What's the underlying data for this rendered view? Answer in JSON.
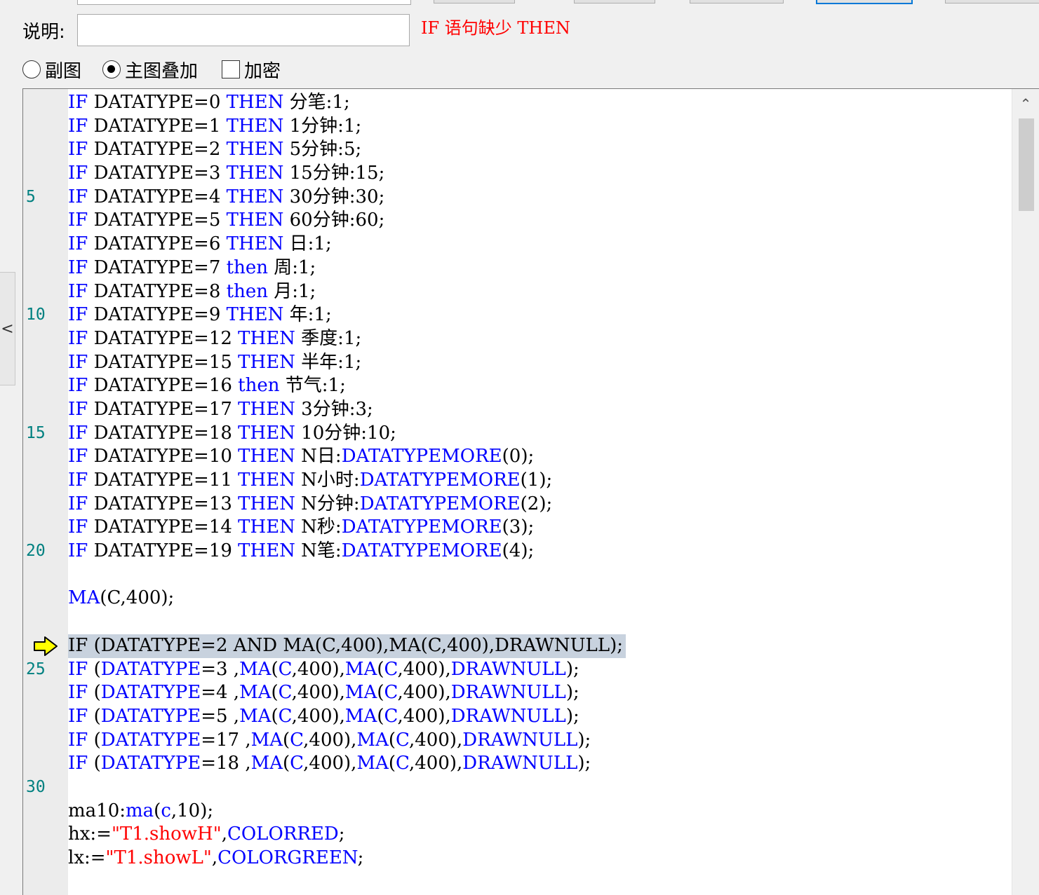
{
  "description": {
    "label": "说明:",
    "value": "",
    "error": "IF 语句缺少 THEN"
  },
  "options": {
    "radio_subchart": "副图",
    "radio_overlay": "主图叠加",
    "radio_selected": "主图叠加",
    "checkbox_encrypt": "加密",
    "checkbox_encrypt_checked": false
  },
  "side_handle": {
    "icon": "chevron-left-icon",
    "glyph": "<"
  },
  "editor": {
    "current_line": 24,
    "lines": [
      {
        "n": "",
        "tokens": [
          {
            "t": "IF",
            "c": "kw"
          },
          {
            "t": " DATATYPE=0 "
          },
          {
            "t": "THEN",
            "c": "kw"
          },
          {
            "t": " 分笔:1;"
          }
        ]
      },
      {
        "n": "",
        "tokens": [
          {
            "t": "IF",
            "c": "kw"
          },
          {
            "t": " DATATYPE=1 "
          },
          {
            "t": "THEN",
            "c": "kw"
          },
          {
            "t": " 1分钟:1;"
          }
        ]
      },
      {
        "n": "",
        "tokens": [
          {
            "t": "IF",
            "c": "kw"
          },
          {
            "t": " DATATYPE=2 "
          },
          {
            "t": "THEN",
            "c": "kw"
          },
          {
            "t": " 5分钟:5;"
          }
        ]
      },
      {
        "n": "",
        "tokens": [
          {
            "t": "IF",
            "c": "kw"
          },
          {
            "t": " DATATYPE=3 "
          },
          {
            "t": "THEN",
            "c": "kw"
          },
          {
            "t": " 15分钟:15;"
          }
        ]
      },
      {
        "n": "5",
        "tokens": [
          {
            "t": "IF",
            "c": "kw"
          },
          {
            "t": " DATATYPE=4 "
          },
          {
            "t": "THEN",
            "c": "kw"
          },
          {
            "t": " 30分钟:30;"
          }
        ]
      },
      {
        "n": "",
        "tokens": [
          {
            "t": "IF",
            "c": "kw"
          },
          {
            "t": " DATATYPE=5 "
          },
          {
            "t": "THEN",
            "c": "kw"
          },
          {
            "t": " 60分钟:60;"
          }
        ]
      },
      {
        "n": "",
        "tokens": [
          {
            "t": "IF",
            "c": "kw"
          },
          {
            "t": " DATATYPE=6 "
          },
          {
            "t": "THEN",
            "c": "kw"
          },
          {
            "t": " 日:1;"
          }
        ]
      },
      {
        "n": "",
        "tokens": [
          {
            "t": "IF",
            "c": "kw"
          },
          {
            "t": " DATATYPE=7 "
          },
          {
            "t": "then",
            "c": "kw"
          },
          {
            "t": " 周:1;"
          }
        ]
      },
      {
        "n": "",
        "tokens": [
          {
            "t": "IF",
            "c": "kw"
          },
          {
            "t": " DATATYPE=8 "
          },
          {
            "t": "then",
            "c": "kw"
          },
          {
            "t": " 月:1;"
          }
        ]
      },
      {
        "n": "10",
        "tokens": [
          {
            "t": "IF",
            "c": "kw"
          },
          {
            "t": " DATATYPE=9 "
          },
          {
            "t": "THEN",
            "c": "kw"
          },
          {
            "t": " 年:1;"
          }
        ]
      },
      {
        "n": "",
        "tokens": [
          {
            "t": "IF",
            "c": "kw"
          },
          {
            "t": " DATATYPE=12 "
          },
          {
            "t": "THEN",
            "c": "kw"
          },
          {
            "t": " 季度:1;"
          }
        ]
      },
      {
        "n": "",
        "tokens": [
          {
            "t": "IF",
            "c": "kw"
          },
          {
            "t": " DATATYPE=15 "
          },
          {
            "t": "THEN",
            "c": "kw"
          },
          {
            "t": " 半年:1;"
          }
        ]
      },
      {
        "n": "",
        "tokens": [
          {
            "t": "IF",
            "c": "kw"
          },
          {
            "t": " DATATYPE=16 "
          },
          {
            "t": "then",
            "c": "kw"
          },
          {
            "t": " 节气:1;"
          }
        ]
      },
      {
        "n": "",
        "tokens": [
          {
            "t": "IF",
            "c": "kw"
          },
          {
            "t": " DATATYPE=17 "
          },
          {
            "t": "THEN",
            "c": "kw"
          },
          {
            "t": " 3分钟:3;"
          }
        ]
      },
      {
        "n": "15",
        "tokens": [
          {
            "t": "IF",
            "c": "kw"
          },
          {
            "t": " DATATYPE=18 "
          },
          {
            "t": "THEN",
            "c": "kw"
          },
          {
            "t": " 10分钟:10;"
          }
        ]
      },
      {
        "n": "",
        "tokens": [
          {
            "t": "IF",
            "c": "kw"
          },
          {
            "t": " DATATYPE=10 "
          },
          {
            "t": "THEN",
            "c": "kw"
          },
          {
            "t": " N日:"
          },
          {
            "t": "DATATYPEMORE",
            "c": "fn"
          },
          {
            "t": "(0);"
          }
        ]
      },
      {
        "n": "",
        "tokens": [
          {
            "t": "IF",
            "c": "kw"
          },
          {
            "t": " DATATYPE=11 "
          },
          {
            "t": "THEN",
            "c": "kw"
          },
          {
            "t": " N小时:"
          },
          {
            "t": "DATATYPEMORE",
            "c": "fn"
          },
          {
            "t": "(1);"
          }
        ]
      },
      {
        "n": "",
        "tokens": [
          {
            "t": "IF",
            "c": "kw"
          },
          {
            "t": " DATATYPE=13 "
          },
          {
            "t": "THEN",
            "c": "kw"
          },
          {
            "t": " N分钟:"
          },
          {
            "t": "DATATYPEMORE",
            "c": "fn"
          },
          {
            "t": "(2);"
          }
        ]
      },
      {
        "n": "",
        "tokens": [
          {
            "t": "IF",
            "c": "kw"
          },
          {
            "t": " DATATYPE=14 "
          },
          {
            "t": "THEN",
            "c": "kw"
          },
          {
            "t": " N秒:"
          },
          {
            "t": "DATATYPEMORE",
            "c": "fn"
          },
          {
            "t": "(3);"
          }
        ]
      },
      {
        "n": "20",
        "tokens": [
          {
            "t": "IF",
            "c": "kw"
          },
          {
            "t": " DATATYPE=19 "
          },
          {
            "t": "THEN",
            "c": "kw"
          },
          {
            "t": " N笔:"
          },
          {
            "t": "DATATYPEMORE",
            "c": "fn"
          },
          {
            "t": "(4);"
          }
        ]
      },
      {
        "n": "",
        "tokens": []
      },
      {
        "n": "",
        "tokens": [
          {
            "t": "MA",
            "c": "fn"
          },
          {
            "t": "(C,400);"
          }
        ]
      },
      {
        "n": "",
        "tokens": []
      },
      {
        "n": "",
        "tokens": [
          {
            "t": "IF (DATATYPE=2 AND MA(C,400),MA(C,400),DRAWNULL);"
          }
        ]
      },
      {
        "n": "25",
        "tokens": [
          {
            "t": "IF",
            "c": "kw"
          },
          {
            "t": " ("
          },
          {
            "t": "DATATYPE",
            "c": "fn"
          },
          {
            "t": "=3 ,"
          },
          {
            "t": "MA",
            "c": "fn"
          },
          {
            "t": "("
          },
          {
            "t": "C",
            "c": "fn"
          },
          {
            "t": ",400),"
          },
          {
            "t": "MA",
            "c": "fn"
          },
          {
            "t": "("
          },
          {
            "t": "C",
            "c": "fn"
          },
          {
            "t": ",400),"
          },
          {
            "t": "DRAWNULL",
            "c": "fn"
          },
          {
            "t": ");"
          }
        ]
      },
      {
        "n": "",
        "tokens": [
          {
            "t": "IF",
            "c": "kw"
          },
          {
            "t": " ("
          },
          {
            "t": "DATATYPE",
            "c": "fn"
          },
          {
            "t": "=4 ,"
          },
          {
            "t": "MA",
            "c": "fn"
          },
          {
            "t": "("
          },
          {
            "t": "C",
            "c": "fn"
          },
          {
            "t": ",400),"
          },
          {
            "t": "MA",
            "c": "fn"
          },
          {
            "t": "("
          },
          {
            "t": "C",
            "c": "fn"
          },
          {
            "t": ",400),"
          },
          {
            "t": "DRAWNULL",
            "c": "fn"
          },
          {
            "t": ");"
          }
        ]
      },
      {
        "n": "",
        "tokens": [
          {
            "t": "IF",
            "c": "kw"
          },
          {
            "t": " ("
          },
          {
            "t": "DATATYPE",
            "c": "fn"
          },
          {
            "t": "=5 ,"
          },
          {
            "t": "MA",
            "c": "fn"
          },
          {
            "t": "("
          },
          {
            "t": "C",
            "c": "fn"
          },
          {
            "t": ",400),"
          },
          {
            "t": "MA",
            "c": "fn"
          },
          {
            "t": "("
          },
          {
            "t": "C",
            "c": "fn"
          },
          {
            "t": ",400),"
          },
          {
            "t": "DRAWNULL",
            "c": "fn"
          },
          {
            "t": ");"
          }
        ]
      },
      {
        "n": "",
        "tokens": [
          {
            "t": "IF",
            "c": "kw"
          },
          {
            "t": " ("
          },
          {
            "t": "DATATYPE",
            "c": "fn"
          },
          {
            "t": "=17 ,"
          },
          {
            "t": "MA",
            "c": "fn"
          },
          {
            "t": "("
          },
          {
            "t": "C",
            "c": "fn"
          },
          {
            "t": ",400),"
          },
          {
            "t": "MA",
            "c": "fn"
          },
          {
            "t": "("
          },
          {
            "t": "C",
            "c": "fn"
          },
          {
            "t": ",400),"
          },
          {
            "t": "DRAWNULL",
            "c": "fn"
          },
          {
            "t": ");"
          }
        ]
      },
      {
        "n": "",
        "tokens": [
          {
            "t": "IF",
            "c": "kw"
          },
          {
            "t": " ("
          },
          {
            "t": "DATATYPE",
            "c": "fn"
          },
          {
            "t": "=18 ,"
          },
          {
            "t": "MA",
            "c": "fn"
          },
          {
            "t": "("
          },
          {
            "t": "C",
            "c": "fn"
          },
          {
            "t": ",400),"
          },
          {
            "t": "MA",
            "c": "fn"
          },
          {
            "t": "("
          },
          {
            "t": "C",
            "c": "fn"
          },
          {
            "t": ",400),"
          },
          {
            "t": "DRAWNULL",
            "c": "fn"
          },
          {
            "t": ");"
          }
        ]
      },
      {
        "n": "30",
        "tokens": []
      },
      {
        "n": "",
        "tokens": [
          {
            "t": "ma10:"
          },
          {
            "t": "ma",
            "c": "fn"
          },
          {
            "t": "("
          },
          {
            "t": "c",
            "c": "fn"
          },
          {
            "t": ",10);"
          }
        ]
      },
      {
        "n": "",
        "tokens": [
          {
            "t": "hx:="
          },
          {
            "t": "\"T1.showH\"",
            "c": "str"
          },
          {
            "t": ","
          },
          {
            "t": "COLORRED",
            "c": "fn"
          },
          {
            "t": ";"
          }
        ]
      },
      {
        "n": "",
        "tokens": [
          {
            "t": "lx:="
          },
          {
            "t": "\"T1.showL\"",
            "c": "str"
          },
          {
            "t": ","
          },
          {
            "t": "COLORGREEN",
            "c": "fn"
          },
          {
            "t": ";"
          }
        ]
      }
    ]
  },
  "scrollbar": {
    "up_icon": "chevron-up-icon",
    "up_glyph": "⌃",
    "position": 0.0
  },
  "colors": {
    "keyword": "#0000ff",
    "string": "#ff0000",
    "line_number": "#008080",
    "error": "#ff0000",
    "current_line_bg": "#c8d2de",
    "arrow": "#ffff00"
  }
}
